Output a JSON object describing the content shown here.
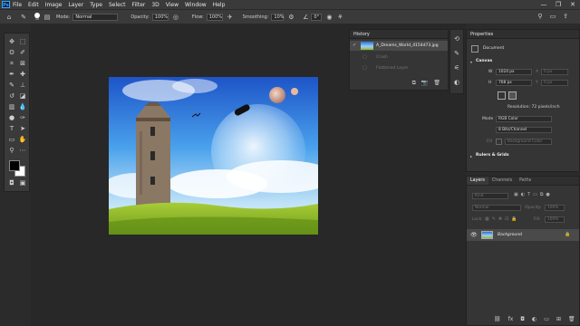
{
  "app": {
    "logo": "Ps"
  },
  "menu": [
    "File",
    "Edit",
    "Image",
    "Layer",
    "Type",
    "Select",
    "Filter",
    "3D",
    "View",
    "Window",
    "Help"
  ],
  "window_controls": [
    "—",
    "❐",
    "✕"
  ],
  "options": {
    "brush_size": "30",
    "mode_label": "Mode:",
    "mode_value": "Normal",
    "opacity_label": "Opacity:",
    "opacity_value": "100%",
    "flow_label": "Flow:",
    "flow_value": "100%",
    "smoothing_label": "Smoothing:",
    "smoothing_value": "10%",
    "angle_value": "0°"
  },
  "history": {
    "title": "History",
    "items": [
      {
        "label": "A_Dreams_World_4154d73.jpg",
        "state": "active"
      },
      {
        "label": "Crash",
        "state": "dim"
      },
      {
        "label": "Flattened Layer",
        "state": "dim"
      }
    ]
  },
  "properties": {
    "title": "Properties",
    "document_label": "Document",
    "canvas_label": "Canvas",
    "w_label": "W",
    "w_value": "1024 px",
    "h_label": "H",
    "h_value": "768 px",
    "x_label": "X",
    "x_value": "0 px",
    "y_label": "Y",
    "y_value": "0 px",
    "resolution": "Resolution: 72 pixels/inch",
    "mode_label": "Mode",
    "mode_value": "RGB Color",
    "depth_value": "8 Bits/Channel",
    "fill_label": "Fill",
    "fill_value": "Background Color",
    "rulers_label": "Rulers & Grids"
  },
  "layers": {
    "tabs": [
      "Layers",
      "Channels",
      "Paths"
    ],
    "kind_placeholder": "Kind",
    "blend_mode": "Normal",
    "opacity_label": "Opacity:",
    "opacity_value": "100%",
    "lock_label": "Lock:",
    "fill_label": "Fill:",
    "fill_value": "100%",
    "layer_name": "Background"
  },
  "colors": {
    "accent": "#36a8ff",
    "panel": "#353535",
    "background": "#282828"
  }
}
